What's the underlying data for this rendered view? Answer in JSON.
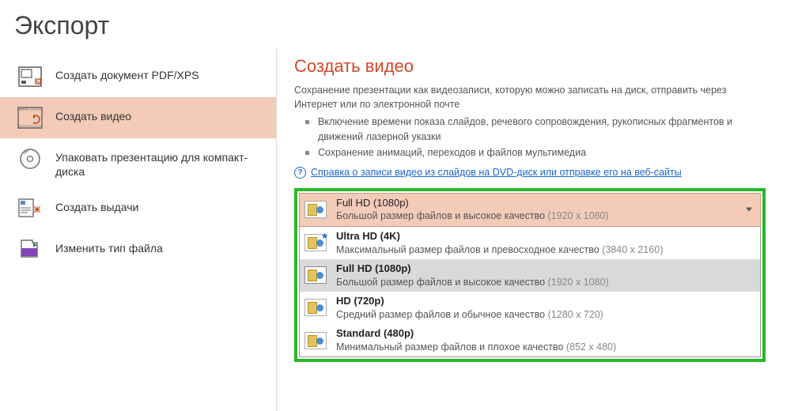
{
  "page_title": "Экспорт",
  "sidebar": {
    "items": [
      {
        "label": "Создать документ PDF/XPS"
      },
      {
        "label": "Создать видео"
      },
      {
        "label": "Упаковать презентацию для компакт-диска"
      },
      {
        "label": "Создать выдачи"
      },
      {
        "label": "Изменить тип файла"
      }
    ]
  },
  "content": {
    "heading": "Создать видео",
    "intro": "Сохранение презентации как видеозаписи, которую можно записать на диск, отправить через Интернет или по электронной почте",
    "bullets": [
      "Включение времени показа слайдов, речевого сопровождения, рукописных фрагментов и движений лазерной указки",
      "Сохранение анимаций, переходов и файлов мультимедиа"
    ],
    "help_link": "Справка о записи видео из слайдов на DVD-диск или отправке его на веб-сайты"
  },
  "quality_dropdown": {
    "selected": {
      "title": "Full HD (1080p)",
      "desc": "Большой размер файлов и высокое качество",
      "dim": "(1920 x 1080)"
    },
    "options": [
      {
        "title": "Ultra HD (4K)",
        "desc": "Максимальный размер файлов и превосходное качество",
        "dim": "(3840 x 2160)",
        "star": true
      },
      {
        "title": "Full HD (1080p)",
        "desc": "Большой размер файлов и высокое качество",
        "dim": "(1920 x 1080)",
        "highlight": true
      },
      {
        "title": "HD (720p)",
        "desc": "Средний размер файлов и обычное качество",
        "dim": "(1280 x 720)"
      },
      {
        "title": "Standard (480p)",
        "desc": "Минимальный размер файлов и плохое качество",
        "dim": "(852 x 480)"
      }
    ]
  }
}
